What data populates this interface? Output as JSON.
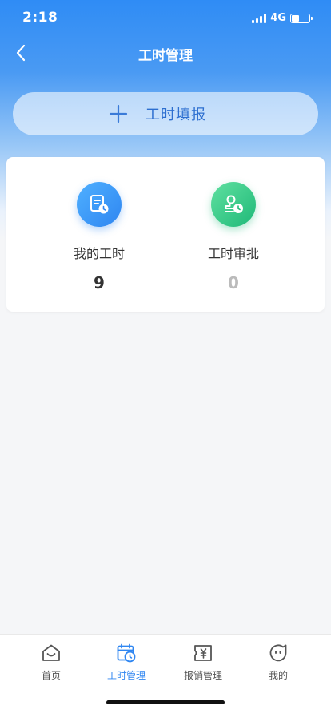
{
  "status_bar": {
    "time": "2:18",
    "network": "4G",
    "battery_level": 0.4
  },
  "nav": {
    "title": "工时管理"
  },
  "report_button": {
    "label": "工时填报"
  },
  "stats": [
    {
      "label": "我的工时",
      "value": "9",
      "value_color": "#333333",
      "icon": "document-clock-icon"
    },
    {
      "label": "工时审批",
      "value": "0",
      "value_color": "#bbbbbb",
      "icon": "stamp-clock-icon"
    }
  ],
  "tabbar": {
    "items": [
      {
        "label": "首页",
        "icon": "home-icon",
        "active": false
      },
      {
        "label": "工时管理",
        "icon": "calendar-clock-icon",
        "active": true
      },
      {
        "label": "报销管理",
        "icon": "receipt-yen-icon",
        "active": false
      },
      {
        "label": "我的",
        "icon": "profile-chat-icon",
        "active": false
      }
    ]
  },
  "colors": {
    "primary": "#2f86f1",
    "accent_green": "#1fb978",
    "background": "#f5f6f8"
  }
}
